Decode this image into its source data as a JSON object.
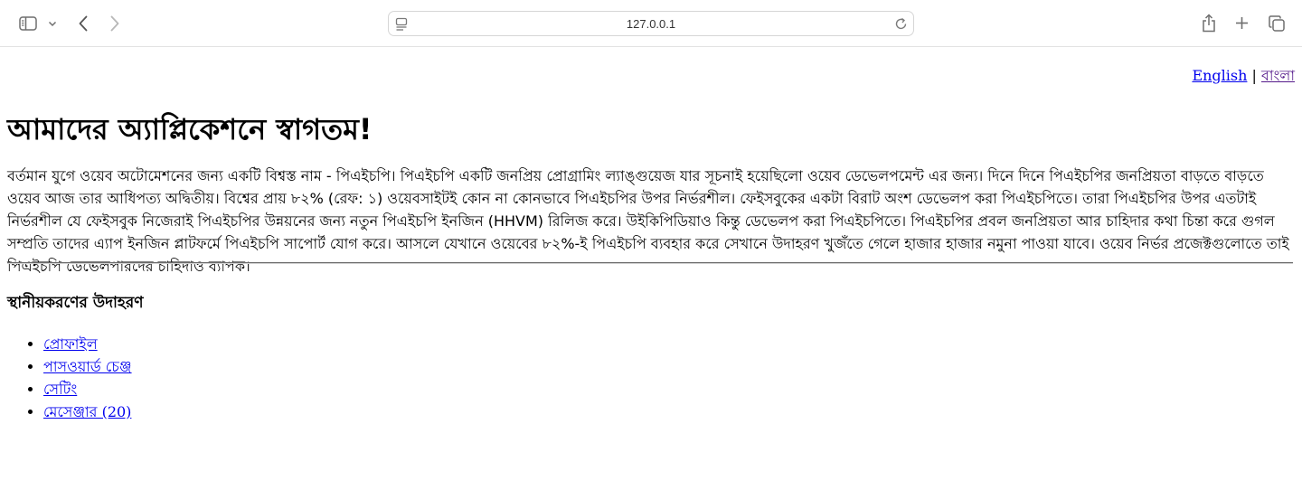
{
  "browser": {
    "url": "127.0.0.1",
    "icons": {
      "sidebar": "sidebar-icon",
      "chevron": "chevron-down-icon",
      "back": "back-arrow-icon",
      "forward": "forward-arrow-icon",
      "page_settings": "page-settings-icon",
      "reload": "reload-icon",
      "share": "share-icon",
      "new_tab": "plus-icon",
      "tabs": "tabs-overview-icon"
    }
  },
  "language_switch": {
    "english": "English",
    "separator": "|",
    "bangla": "বাংলা"
  },
  "page": {
    "title": "আমাদের অ্যাপ্লিকেশনে স্বাগতম!",
    "intro": "বর্তমান যুগে ওয়েব অটোমেশনের জন্য একটি বিশ্বস্ত নাম - পিএইচপি। পিএইচপি একটি জনপ্রিয় প্রোগ্রামিং ল্যাঙ্গুয়েজ যার সূচনাই হয়েছিলো ওয়েব ডেভেলপমেন্ট এর জন্য। দিনে দিনে পিএইচপির জনপ্রিয়তা বাড়তে বাড়তে ওয়েব আজ তার আধিপত্য অদ্বিতীয়। বিশ্বের প্রায় ৮২% (রেফ: ১) ওয়েবসাইটই কোন না কোনভাবে পিএইচপির উপর নির্ভরশীল। ফেইসবুকের একটা বিরাট অংশ ডেভেলপ করা পিএইচপিতে। তারা পিএইচপির উপর এতটাই নির্ভরশীল যে ফেইসবুক নিজেরাই পিএইচপির উন্নয়নের জন্য নতুন পিএইচপি ইনজিন (HHVM) রিলিজ করে। উইকিপিডিয়াও কিন্তু ডেভেলপ করা পিএইচপিতে। পিএইচপির প্রবল জনপ্রিয়তা আর চাহিদার কথা চিন্তা করে গুগল সম্প্রতি তাদের এ্যাপ ইনজিন প্লাটফর্মে পিএইচপি সাপোর্ট যোগ করে। আসলে যেখানে ওয়েবের ৮২%-ই পিএইচপি ব্যবহার করে সেখানে উদাহরণ খুজঁতে গেলে হাজার হাজার নমুনা পাওয়া যাবে। ওয়েব নির্ভর প্রজেক্টগুলোতে তাই পিএইচপি ডেভেলপারদের চাহিদাও ব্যাপক।",
    "section_heading": "স্থানীয়করণের উদাহরণ",
    "links": [
      "প্রোফাইল",
      "পাসওয়ার্ড চেঞ্জ",
      "সেটিং",
      "মেসেঞ্জার (20)"
    ]
  }
}
